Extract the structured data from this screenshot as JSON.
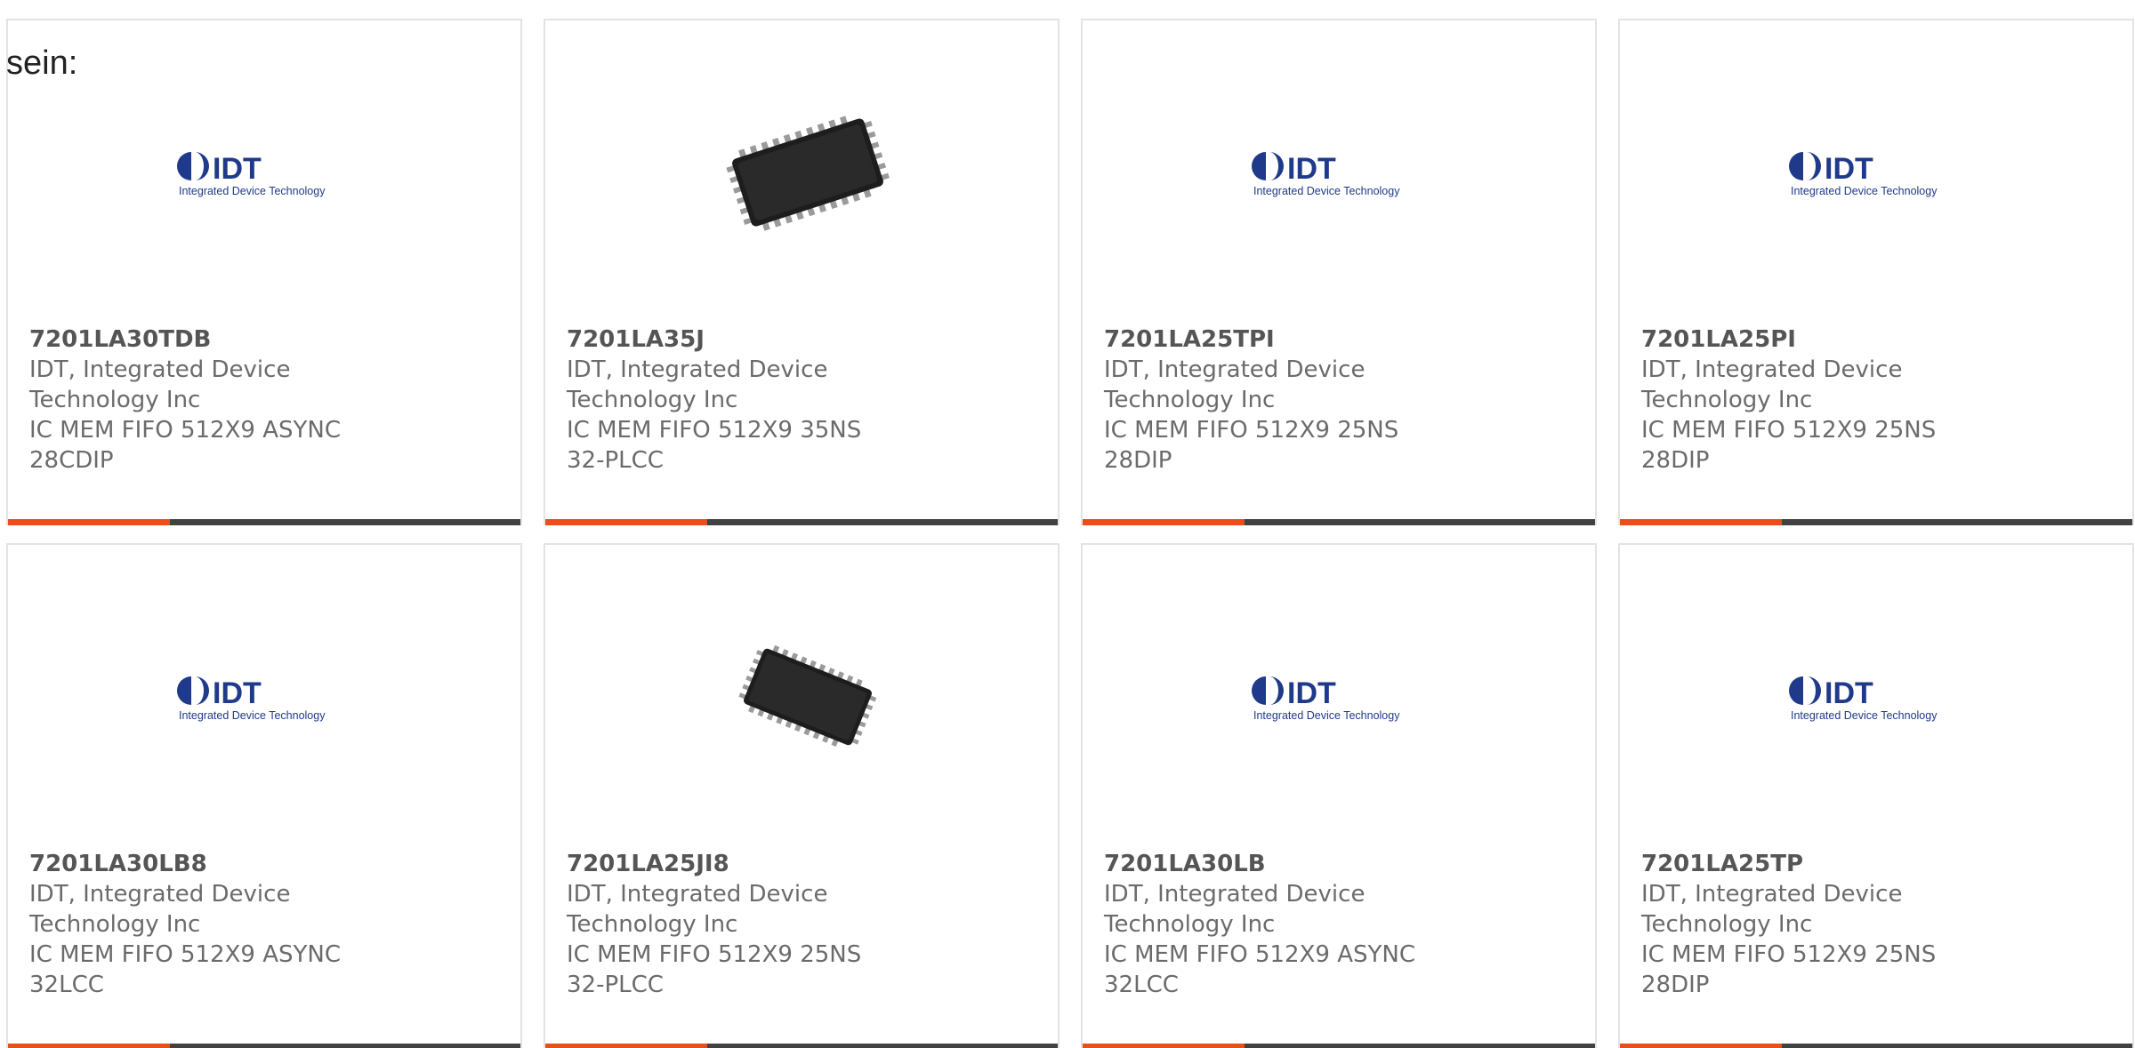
{
  "intro_text": "sein:",
  "colors": {
    "accent": "#e94e1b",
    "bar": "#414141",
    "border": "#e3e3e3",
    "text": "#6b6b6b",
    "idt_blue": "#1f3a8a"
  },
  "logo_text": {
    "brand": "IDT",
    "tagline": "Integrated Device Technology"
  },
  "products": [
    {
      "part_number": "7201LA30TDB",
      "manufacturer": "IDT, Integrated Device Technology Inc",
      "description": "IC MEM FIFO 512X9 ASYNC 28CDIP",
      "image": "idt-logo"
    },
    {
      "part_number": "7201LA35J",
      "manufacturer": "IDT, Integrated Device Technology Inc",
      "description": "IC MEM FIFO 512X9 35NS 32-PLCC",
      "image": "plcc-chip"
    },
    {
      "part_number": "7201LA25TPI",
      "manufacturer": "IDT, Integrated Device Technology Inc",
      "description": "IC MEM FIFO 512X9 25NS 28DIP",
      "image": "idt-logo"
    },
    {
      "part_number": "7201LA25PI",
      "manufacturer": "IDT, Integrated Device Technology Inc",
      "description": "IC MEM FIFO 512X9 25NS 28DIP",
      "image": "idt-logo"
    },
    {
      "part_number": "7201LA30LB8",
      "manufacturer": "IDT, Integrated Device Technology Inc",
      "description": "IC MEM FIFO 512X9 ASYNC 32LCC",
      "image": "idt-logo"
    },
    {
      "part_number": "7201LA25JI8",
      "manufacturer": "IDT, Integrated Device Technology Inc",
      "description": "IC MEM FIFO 512X9 25NS 32-PLCC",
      "image": "plcc-chip-small"
    },
    {
      "part_number": "7201LA30LB",
      "manufacturer": "IDT, Integrated Device Technology Inc",
      "description": "IC MEM FIFO 512X9 ASYNC 32LCC",
      "image": "idt-logo"
    },
    {
      "part_number": "7201LA25TP",
      "manufacturer": "IDT, Integrated Device Technology Inc",
      "description": "IC MEM FIFO 512X9 25NS 28DIP",
      "image": "idt-logo"
    }
  ]
}
